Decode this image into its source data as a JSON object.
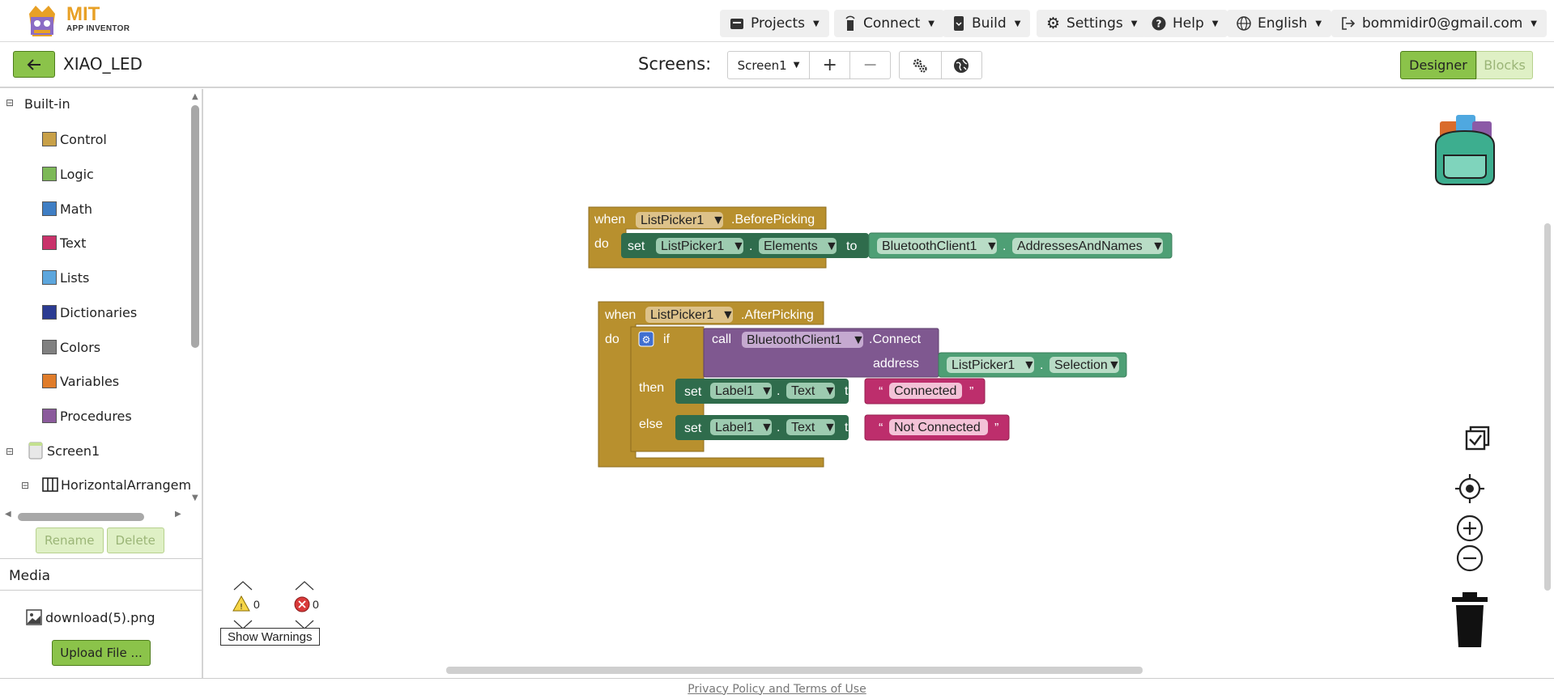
{
  "header": {
    "logo_main": "MIT",
    "logo_sub": "APP INVENTOR",
    "menu": {
      "projects": "Projects",
      "connect": "Connect",
      "build": "Build",
      "settings": "Settings",
      "help": "Help",
      "language": "English",
      "account": "bommidir0@gmail.com"
    }
  },
  "toolbar": {
    "project_name": "XIAO_LED",
    "screens_label": "Screens:",
    "current_screen": "Screen1",
    "add_screen": "+",
    "remove_screen": "−",
    "designer_label": "Designer",
    "blocks_label": "Blocks"
  },
  "sidebar": {
    "builtin_label": "Built-in",
    "categories": [
      {
        "label": "Control",
        "color": "#c8a048"
      },
      {
        "label": "Logic",
        "color": "#7cb857"
      },
      {
        "label": "Math",
        "color": "#3f7ec4"
      },
      {
        "label": "Text",
        "color": "#c9326a"
      },
      {
        "label": "Lists",
        "color": "#5ca6dd"
      },
      {
        "label": "Dictionaries",
        "color": "#2b3b92"
      },
      {
        "label": "Colors",
        "color": "#808080"
      },
      {
        "label": "Variables",
        "color": "#e07c2a"
      },
      {
        "label": "Procedures",
        "color": "#8b5a9c"
      }
    ],
    "screen_node": "Screen1",
    "component_node": "HorizontalArrangem",
    "rename_label": "Rename",
    "delete_label": "Delete",
    "media_title": "Media",
    "media_file": "download(5).png",
    "upload_label": "Upload File ..."
  },
  "blocks": {
    "when": "when",
    "do": "do",
    "set": "set",
    "to": "to",
    "call": "call",
    "if": "if",
    "then": "then",
    "else": "else",
    "address": "address",
    "dot": ".",
    "b1_component": "ListPicker1",
    "b1_event": ".BeforePicking",
    "b1_set_component": "ListPicker1",
    "b1_set_prop": "Elements",
    "b1_value_component": "BluetoothClient1",
    "b1_value_prop": "AddressesAndNames",
    "b2_component": "ListPicker1",
    "b2_event": ".AfterPicking",
    "b2_call_component": "BluetoothClient1",
    "b2_call_method": ".Connect",
    "b2_addr_component": "ListPicker1",
    "b2_addr_prop": "Selection",
    "b2_then_component": "Label1",
    "b2_then_prop": "Text",
    "b2_then_text": "Connected",
    "b2_else_component": "Label1",
    "b2_else_prop": "Text",
    "b2_else_text": "Not Connected",
    "quote_open": "“",
    "quote_close": "”"
  },
  "warnings": {
    "warning_count": "0",
    "error_count": "0",
    "show_label": "Show Warnings"
  },
  "footer": {
    "privacy": "Privacy Policy and Terms of Use"
  },
  "colors": {
    "event": "#b8902e",
    "setter": "#2f6c4c",
    "component": "#4e9f75",
    "procedure": "#7f5890",
    "text": "#bd2e6c",
    "accent_green": "#8bc34a"
  }
}
